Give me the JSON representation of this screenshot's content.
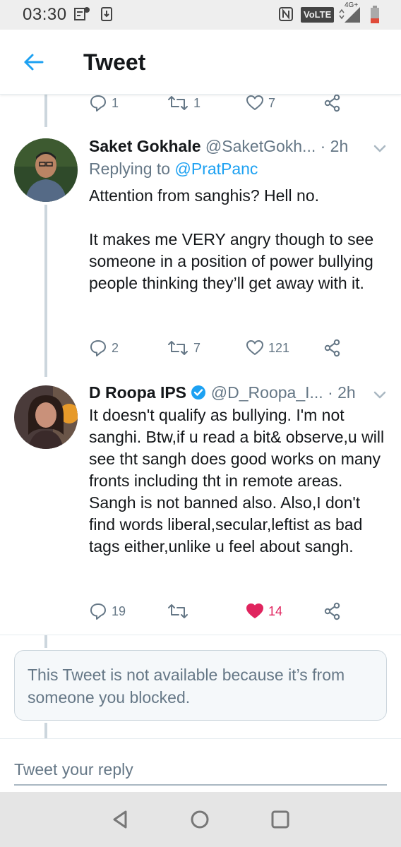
{
  "status_bar": {
    "time": "03:30",
    "network_label": "VoLTE",
    "signal_label": "4G+"
  },
  "app_bar": {
    "title": "Tweet",
    "back_icon": "arrow-left-icon"
  },
  "prev_actions": {
    "reply_count": "1",
    "retweet_count": "1",
    "like_count": "7"
  },
  "tweets": [
    {
      "name": "Saket Gokhale",
      "handle": "@SaketGokh...",
      "time": "· 2h",
      "reply_prefix": "Replying to ",
      "reply_mention": "@PratPanc",
      "text": "Attention from sanghis? Hell no.\n\nIt makes me VERY angry though to see someone in a position of power bullying people thinking they’ll get away with it.",
      "reply_count": "2",
      "retweet_count": "7",
      "like_count": "121"
    },
    {
      "name": "D Roopa IPS",
      "verified": true,
      "handle": "@D_Roopa_I...",
      "time": "· 2h",
      "text": "It doesn't qualify as bullying. I'm not sanghi. Btw,if u read a bit& observe,u will see tht sangh does good works on many fronts including tht in remote areas. Sangh is not banned also. Also,I don't find words  liberal,secular,leftist as bad tags either,unlike u feel about sangh.",
      "reply_count": "19",
      "retweet_count": "",
      "like_count": "14",
      "liked": true
    }
  ],
  "blocked_notice": "This Tweet is not available because it’s from someone you blocked.",
  "reply_box": {
    "placeholder": "Tweet your reply"
  },
  "colors": {
    "accent": "#1da1f2",
    "like": "#e0245e",
    "muted": "#657786",
    "verified": "#1da1f2"
  }
}
